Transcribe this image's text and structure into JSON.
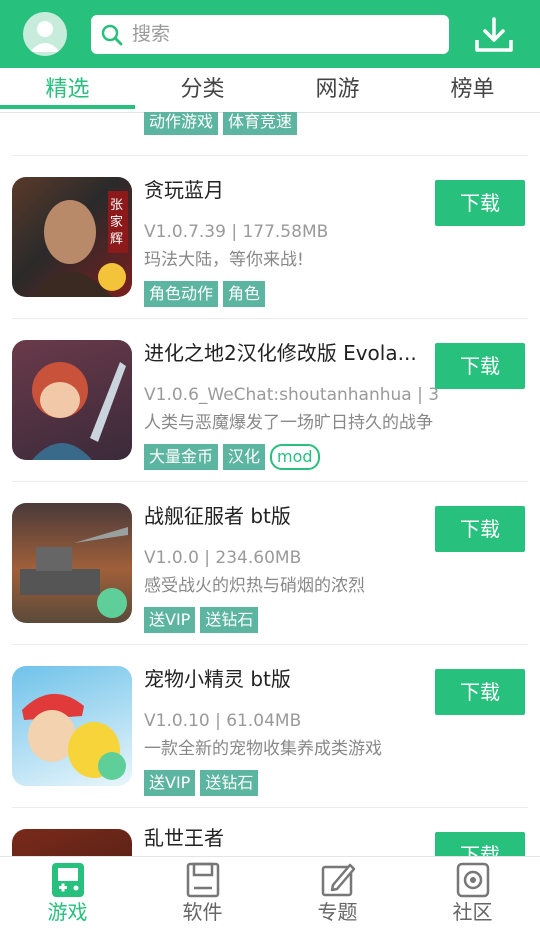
{
  "search": {
    "placeholder": "搜索"
  },
  "tabs": [
    {
      "label": "精选"
    },
    {
      "label": "分类"
    },
    {
      "label": "网游"
    },
    {
      "label": "榜单"
    }
  ],
  "prev_item_tags": [
    "动作游戏",
    "体育竞速"
  ],
  "apps": [
    {
      "name": "贪玩蓝月",
      "meta": "V1.0.7.39 | 177.58MB",
      "desc": "玛法大陆，等你来战!",
      "tags": [
        "角色动作",
        "角色"
      ],
      "download": "下载",
      "icon_text": "张家辉"
    },
    {
      "name": "进化之地2汉化修改版 Evola...",
      "meta": "V1.0.6_WeChat:shoutanhanhua | 3",
      "desc": "人类与恶魔爆发了一场旷日持久的战争",
      "tags": [
        "大量金币",
        "汉化",
        "mod"
      ],
      "download": "下载"
    },
    {
      "name": "战舰征服者 bt版",
      "meta": "V1.0.0 | 234.60MB",
      "desc": "感受战火的炽热与硝烟的浓烈",
      "tags": [
        "送VIP",
        "送钻石"
      ],
      "download": "下载"
    },
    {
      "name": "宠物小精灵 bt版",
      "meta": "V1.0.10 | 61.04MB",
      "desc": "一款全新的宠物收集养成类游戏",
      "tags": [
        "送VIP",
        "送钻石"
      ],
      "download": "下载"
    },
    {
      "name": "乱世王者",
      "download": "下载"
    }
  ],
  "bottom_nav": [
    {
      "label": "游戏"
    },
    {
      "label": "软件"
    },
    {
      "label": "专题"
    },
    {
      "label": "社区"
    }
  ],
  "colors": {
    "primary": "#27c07d",
    "tag": "#5cb5a0"
  }
}
